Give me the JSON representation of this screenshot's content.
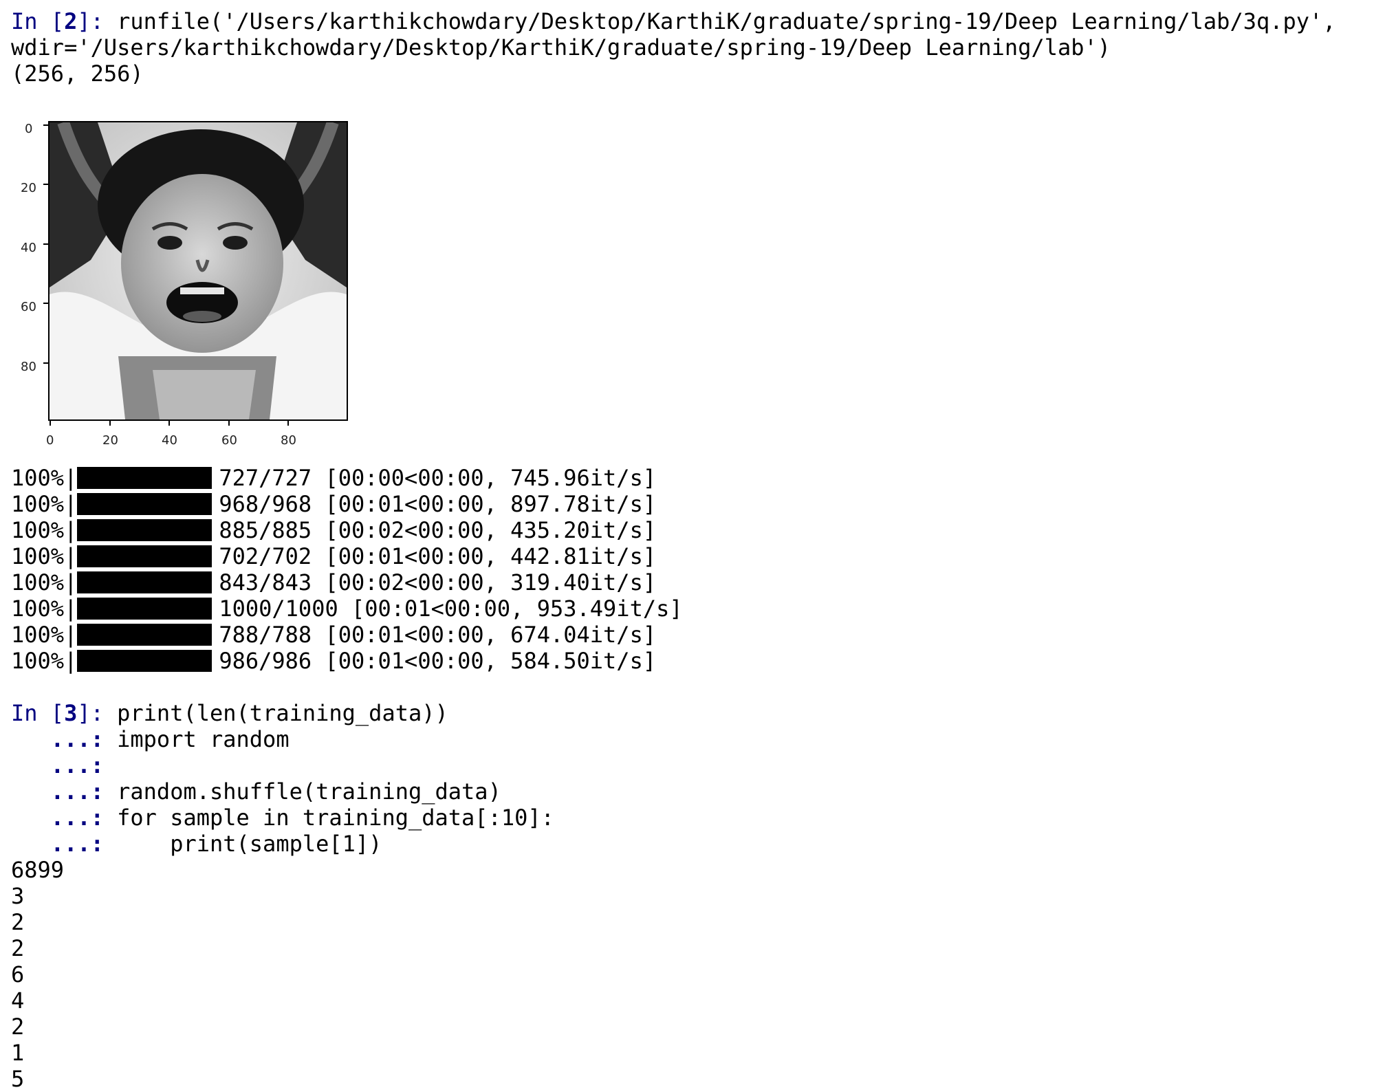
{
  "cells": {
    "in2": {
      "prompt_label": "In [",
      "prompt_number": "2",
      "prompt_close": "]:",
      "code_line1": " runfile('/Users/karthikchowdary/Desktop/KarthiK/graduate/spring-19/Deep Learning/lab/3q.py',",
      "code_line2": "wdir='/Users/karthikchowdary/Desktop/KarthiK/graduate/spring-19/Deep Learning/lab')",
      "output_shape": "(256, 256)"
    },
    "figure": {
      "description_icon": "grayscale-face-image",
      "y_ticks": [
        "0",
        "20",
        "40",
        "60",
        "80"
      ],
      "x_ticks": [
        "0",
        "20",
        "40",
        "60",
        "80"
      ]
    },
    "progress": [
      {
        "percent_text": "100%",
        "fraction": 1.0,
        "stats": "727/727 [00:00<00:00, 745.96it/s]"
      },
      {
        "percent_text": "100%",
        "fraction": 1.0,
        "stats": "968/968 [00:01<00:00, 897.78it/s]"
      },
      {
        "percent_text": "100%",
        "fraction": 1.0,
        "stats": "885/885 [00:02<00:00, 435.20it/s]"
      },
      {
        "percent_text": "100%",
        "fraction": 1.0,
        "stats": "702/702 [00:01<00:00, 442.81it/s]"
      },
      {
        "percent_text": "100%",
        "fraction": 1.0,
        "stats": "843/843 [00:02<00:00, 319.40it/s]"
      },
      {
        "percent_text": "100%",
        "fraction": 1.0,
        "stats": "1000/1000 [00:01<00:00, 953.49it/s]"
      },
      {
        "percent_text": "100%",
        "fraction": 1.0,
        "stats": "788/788 [00:01<00:00, 674.04it/s]"
      },
      {
        "percent_text": "100%",
        "fraction": 1.0,
        "stats": "986/986 [00:01<00:00, 584.50it/s]"
      }
    ],
    "in3": {
      "prompt_label": "In [",
      "prompt_number": "3",
      "prompt_close": "]:",
      "cont_prompt": "   ...:",
      "code_lines": [
        " print(len(training_data))",
        " import random",
        "",
        " random.shuffle(training_data)",
        " for sample in training_data[:10]:",
        "     print(sample[1])"
      ],
      "output_lines": [
        "6899",
        "3",
        "2",
        "2",
        "6",
        "4",
        "2",
        "1",
        "5"
      ]
    }
  },
  "colors": {
    "prompt": "#000080",
    "text": "#000000",
    "background": "#ffffff"
  }
}
